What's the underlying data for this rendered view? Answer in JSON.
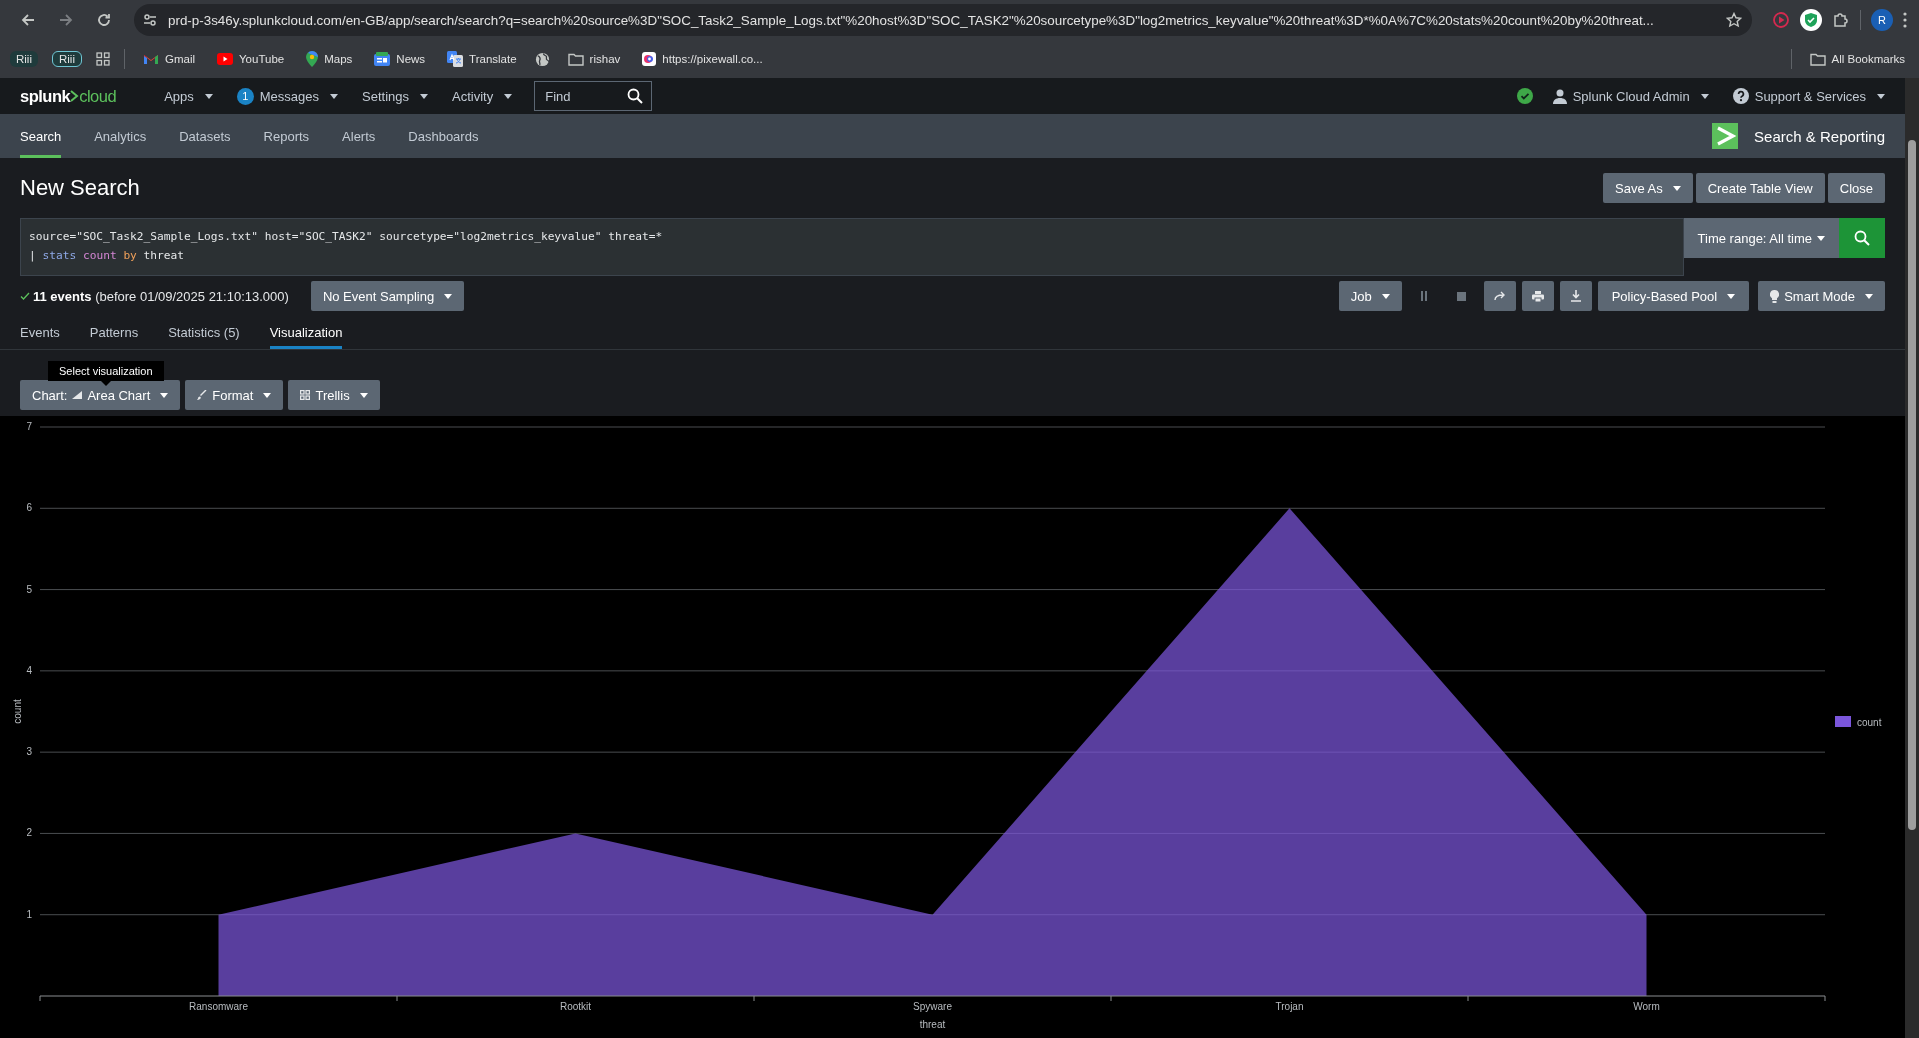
{
  "browser": {
    "url": "prd-p-3s46y.splunkcloud.com/en-GB/app/search/search?q=search%20source%3D\"SOC_Task2_Sample_Logs.txt\"%20host%3D\"SOC_TASK2\"%20sourcetype%3D\"log2metrics_keyvalue\"%20threat%3D*%0A%7C%20stats%20count%20by%20threat...",
    "profile_initial": "R"
  },
  "bookmarks": [
    {
      "kind": "profile",
      "label": "Riii"
    },
    {
      "kind": "profile-outline",
      "label": "Riii"
    },
    {
      "kind": "apps"
    },
    {
      "kind": "gmail",
      "label": "Gmail"
    },
    {
      "kind": "youtube",
      "label": "YouTube"
    },
    {
      "kind": "maps",
      "label": "Maps"
    },
    {
      "kind": "news",
      "label": "News"
    },
    {
      "kind": "translate",
      "label": "Translate"
    },
    {
      "kind": "globe"
    },
    {
      "kind": "folder",
      "label": "rishav"
    },
    {
      "kind": "pixewall",
      "label": "https://pixewall.co..."
    }
  ],
  "all_bookmarks": "All Bookmarks",
  "splunk_nav": {
    "logo": {
      "brand": "splunk",
      "product": "cloud"
    },
    "menus": [
      {
        "label": "Apps"
      },
      {
        "label": "Messages",
        "badge": "1"
      },
      {
        "label": "Settings"
      },
      {
        "label": "Activity"
      }
    ],
    "find": {
      "placeholder": "Find"
    },
    "user": "Splunk Cloud Admin",
    "support": "Support & Services"
  },
  "app_bar": {
    "tabs": [
      {
        "label": "Search",
        "selected": true
      },
      {
        "label": "Analytics",
        "selected": false
      },
      {
        "label": "Datasets",
        "selected": false
      },
      {
        "label": "Reports",
        "selected": false
      },
      {
        "label": "Alerts",
        "selected": false
      },
      {
        "label": "Dashboards",
        "selected": false
      }
    ],
    "app_name": "Search & Reporting"
  },
  "search": {
    "title": "New Search",
    "actions": [
      {
        "label": "Save As",
        "kind": "dropdown"
      },
      {
        "label": "Create Table View",
        "kind": "plain"
      },
      {
        "label": "Close",
        "kind": "plain"
      }
    ],
    "query": [
      [
        {
          "kind": "text",
          "text": "source=\"SOC_Task2_Sample_Logs.txt\" host=\"SOC_TASK2\" sourcetype=\"log2metrics_keyvalue\" threat=*"
        }
      ],
      [
        {
          "kind": "pipe",
          "text": "|"
        },
        {
          "kind": "command",
          "text": "stats"
        },
        {
          "kind": "function",
          "text": "count"
        },
        {
          "kind": "keyword",
          "text": "by"
        },
        {
          "kind": "text",
          "text": "threat"
        }
      ]
    ],
    "time_range": "Time range: All time",
    "status": "**11 events** (before 01/09/2025 21:10:13.000)",
    "sampling": "No Event Sampling",
    "job": "Job",
    "pool": "Policy-Based Pool",
    "mode": "Smart Mode",
    "result_tabs": [
      {
        "label": "Events",
        "selected": false
      },
      {
        "label": "Patterns",
        "selected": false
      },
      {
        "label": "Statistics (5)",
        "selected": false
      },
      {
        "label": "Visualization",
        "selected": true
      }
    ],
    "tooltip": "Select visualization",
    "viz_buttons": [
      {
        "kind": "chart",
        "prefix": "Chart:",
        "label": "Area Chart"
      },
      {
        "kind": "format",
        "label": "Format"
      },
      {
        "kind": "trellis",
        "label": "Trellis"
      }
    ]
  },
  "chart_data": {
    "type": "area",
    "xlabel": "threat",
    "ylabel": "count",
    "categories": [
      "Ransomware",
      "Rootkit",
      "Spyware",
      "Trojan",
      "Worm"
    ],
    "series": [
      {
        "name": "count",
        "color": "#7b56db",
        "values": [
          1,
          2,
          1,
          6,
          1
        ]
      }
    ],
    "grid": true,
    "ylim": [
      0,
      7
    ],
    "yticks": [
      1,
      2,
      3,
      4,
      5,
      6,
      7
    ]
  }
}
